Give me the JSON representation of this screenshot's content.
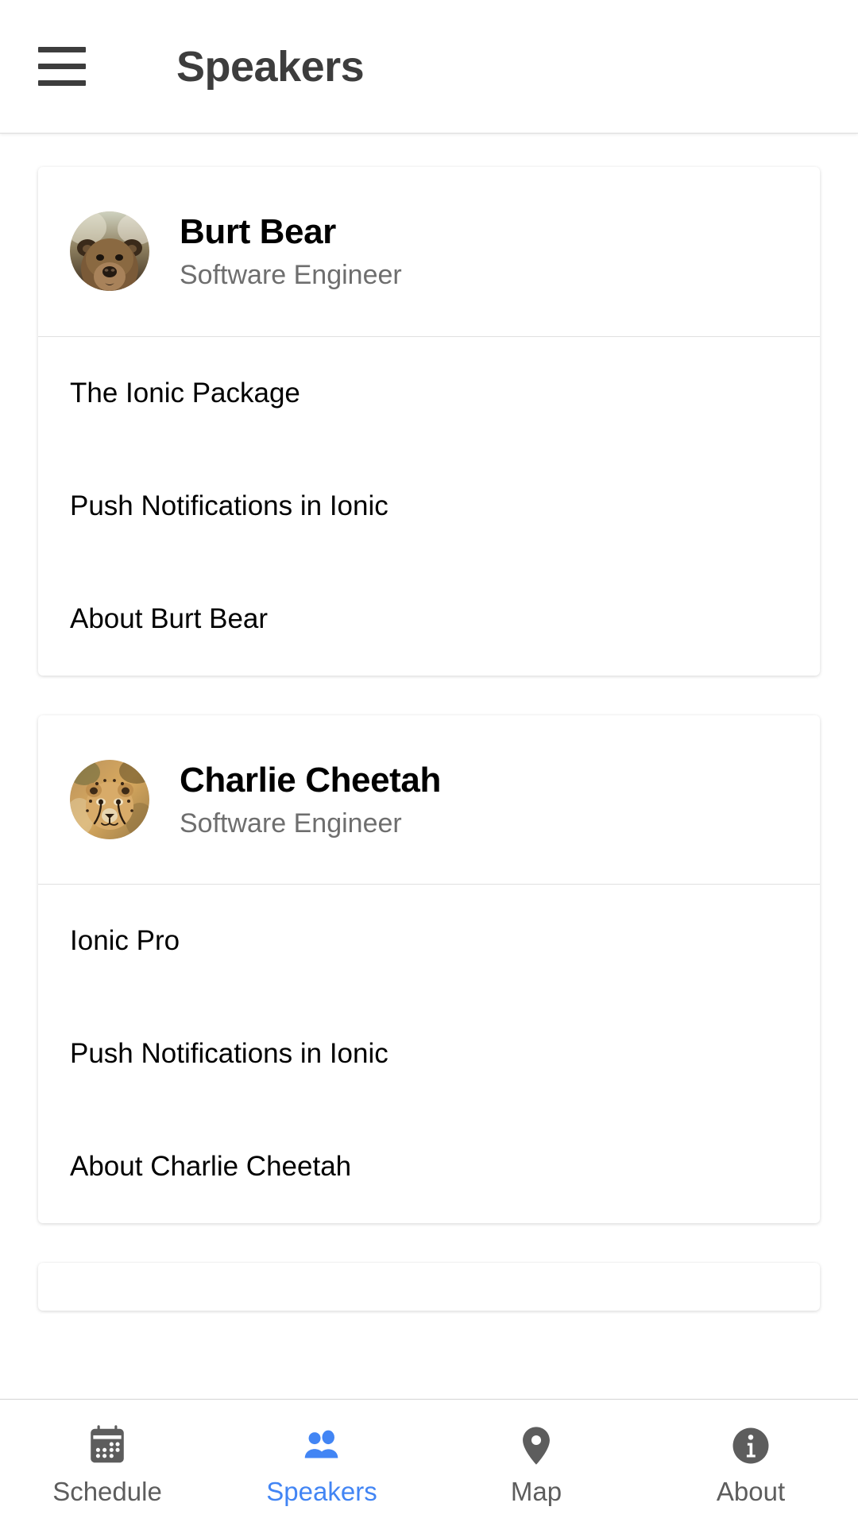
{
  "header": {
    "menu_icon": "hamburger-menu-icon",
    "title": "Speakers"
  },
  "colors": {
    "accent": "#4285F4",
    "icon_gray": "#5d5d5d",
    "title_gray": "#3d3d3d",
    "subtitle_gray": "#6e6e6e",
    "card_bg": "#FFFFFF",
    "page_bg": "#FFFFFF",
    "divider": "#e0e0e0"
  },
  "speakers": [
    {
      "name": "Burt Bear",
      "title": "Software Engineer",
      "avatar": "bear-avatar",
      "sessions": [
        "The Ionic Package",
        "Push Notifications in Ionic",
        "About Burt Bear"
      ]
    },
    {
      "name": "Charlie Cheetah",
      "title": "Software Engineer",
      "avatar": "cheetah-avatar",
      "sessions": [
        "Ionic Pro",
        "Push Notifications in Ionic",
        "About Charlie Cheetah"
      ]
    }
  ],
  "tabs": [
    {
      "label": "Schedule",
      "icon": "calendar-icon",
      "active": false
    },
    {
      "label": "Speakers",
      "icon": "people-icon",
      "active": true
    },
    {
      "label": "Map",
      "icon": "location-pin-icon",
      "active": false
    },
    {
      "label": "About",
      "icon": "info-circle-icon",
      "active": false
    }
  ]
}
